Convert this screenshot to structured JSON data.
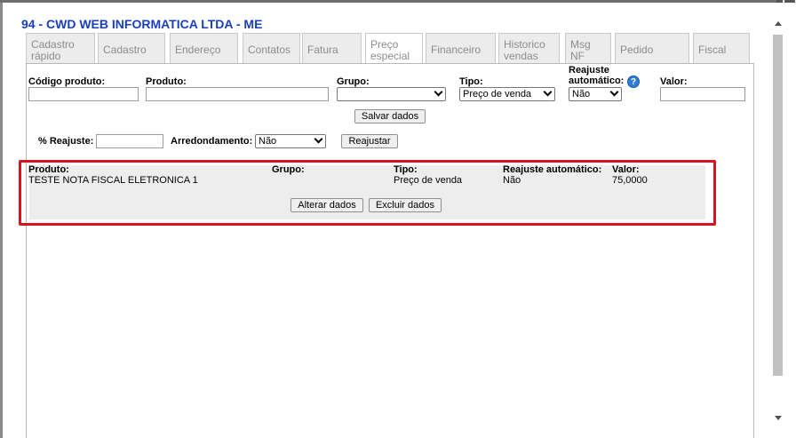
{
  "window": {
    "title": "94 - CWD WEB INFORMATICA LTDA - ME"
  },
  "tabs": [
    {
      "label": "Cadastro rápido"
    },
    {
      "label": "Cadastro"
    },
    {
      "label": "Endereço"
    },
    {
      "label": "Contatos"
    },
    {
      "label": "Fatura"
    },
    {
      "label": "Preço especial"
    },
    {
      "label": "Financeiro"
    },
    {
      "label": "Historico vendas"
    },
    {
      "label": "Msg NF"
    },
    {
      "label": "Pedido"
    },
    {
      "label": "Fiscal"
    }
  ],
  "active_tab": "Preço especial",
  "form": {
    "codigo_label": "Código produto:",
    "codigo_value": "",
    "produto_label": "Produto:",
    "produto_value": "",
    "grupo_label": "Grupo:",
    "grupo_value": "",
    "tipo_label": "Tipo:",
    "tipo_value": "Preço de venda",
    "reajuste_label": "Reajuste automático:",
    "reajuste_value": "Não",
    "help_icon_text": "?",
    "valor_label": "Valor:",
    "valor_value": "",
    "save_button": "Salvar dados"
  },
  "adjust": {
    "percent_label": "% Reajuste:",
    "percent_value": "",
    "rounding_label": "Arredondamento:",
    "rounding_value": "Não",
    "apply_button": "Reajustar"
  },
  "record": {
    "produto_label": "Produto:",
    "produto_value": "TESTE NOTA FISCAL ELETRONICA 1",
    "grupo_label": "Grupo:",
    "grupo_value": "",
    "tipo_label": "Tipo:",
    "tipo_value": "Preço de venda",
    "reajuste_label": "Reajuste automático:",
    "reajuste_value": "Não",
    "valor_label": "Valor:",
    "valor_value": "75,0000",
    "edit_button": "Alterar dados",
    "delete_button": "Excluir dados"
  },
  "colors": {
    "title": "#1a3fb8",
    "highlight_border": "#d9141e",
    "help_icon": "#2f7dd6"
  }
}
